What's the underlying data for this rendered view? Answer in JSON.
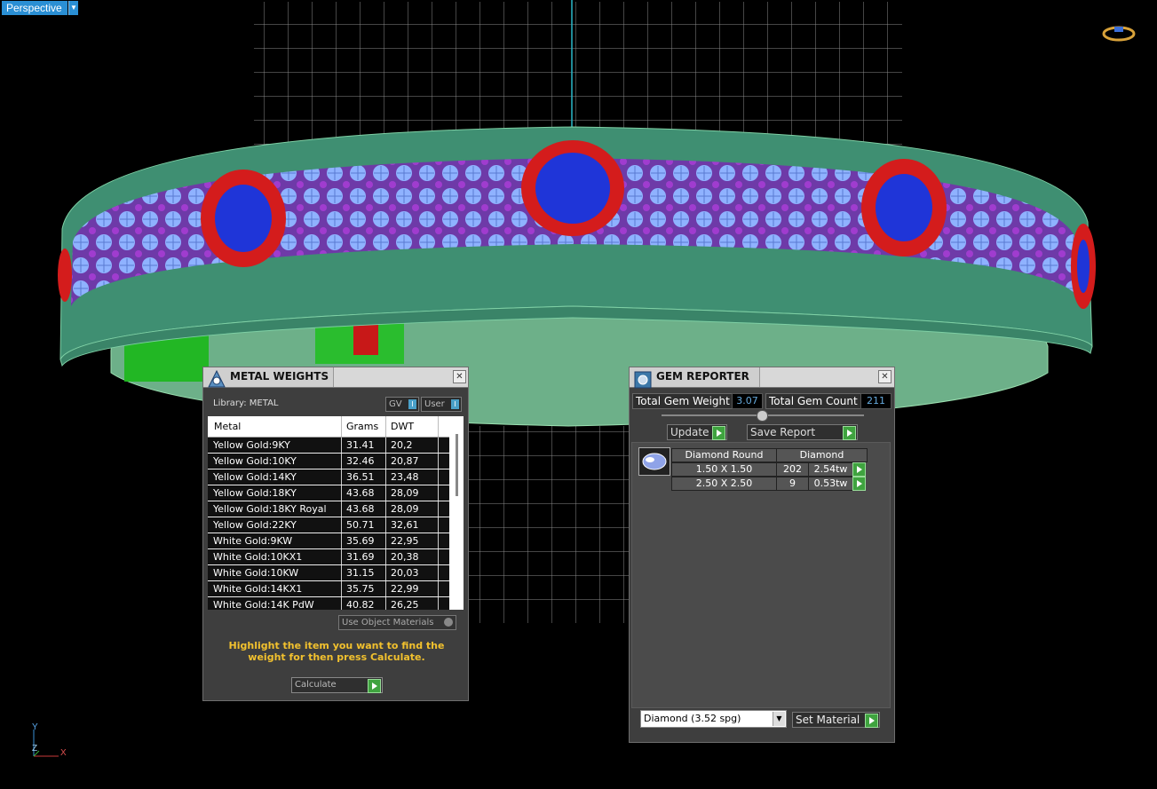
{
  "viewport": {
    "label": "Perspective"
  },
  "axis": {
    "y": "Y",
    "z": "Z",
    "x": "X"
  },
  "metal_weights": {
    "title": "METAL WEIGHTS",
    "library_label": "Library: METAL",
    "toggle_gv": "GV",
    "toggle_user": "User",
    "columns": [
      "Metal",
      "Grams",
      "DWT"
    ],
    "rows": [
      {
        "metal": "Yellow Gold:9KY",
        "grams": "31.41",
        "dwt": "20,2"
      },
      {
        "metal": "Yellow Gold:10KY",
        "grams": "32.46",
        "dwt": "20,87"
      },
      {
        "metal": "Yellow Gold:14KY",
        "grams": "36.51",
        "dwt": "23,48"
      },
      {
        "metal": "Yellow Gold:18KY",
        "grams": "43.68",
        "dwt": "28,09"
      },
      {
        "metal": "Yellow Gold:18KY Royal",
        "grams": "43.68",
        "dwt": "28,09"
      },
      {
        "metal": "Yellow Gold:22KY",
        "grams": "50.71",
        "dwt": "32,61"
      },
      {
        "metal": "White Gold:9KW",
        "grams": "35.69",
        "dwt": "22,95"
      },
      {
        "metal": "White Gold:10KX1",
        "grams": "31.69",
        "dwt": "20,38"
      },
      {
        "metal": "White Gold:10KW",
        "grams": "31.15",
        "dwt": "20,03"
      },
      {
        "metal": "White Gold:14KX1",
        "grams": "35.75",
        "dwt": "22,99"
      },
      {
        "metal": "White Gold:14K PdW",
        "grams": "40.82",
        "dwt": "26,25"
      }
    ],
    "use_object_materials": "Use Object Materials",
    "hint": "Highlight the item you want to find the weight for then press Calculate.",
    "calculate_label": "Calculate"
  },
  "gem_reporter": {
    "title": "GEM REPORTER",
    "total_weight_label": "Total Gem Weight",
    "total_weight_value": "3.07",
    "total_count_label": "Total Gem Count",
    "total_count_value": "211",
    "update_label": "Update",
    "save_report_label": "Save Report",
    "gem_header_shape": "Diamond Round",
    "gem_header_material": "Diamond",
    "gem_rows": [
      {
        "size": "1.50 X 1.50",
        "count": "202",
        "weight": "2.54tw"
      },
      {
        "size": "2.50 X 2.50",
        "count": "9",
        "weight": "0.53tw"
      }
    ],
    "material_select": "Diamond     (3.52 spg)",
    "set_material_label": "Set Material"
  },
  "colors": {
    "accent": "#2a8fd4",
    "hint": "#f2c12e",
    "go": "#3fa33f",
    "ring": "#3f8f72"
  }
}
